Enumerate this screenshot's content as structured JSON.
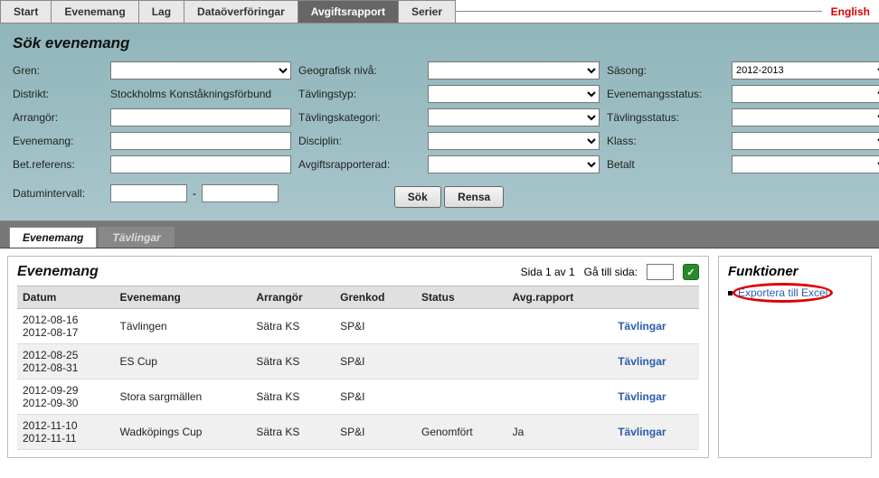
{
  "nav": {
    "tabs": [
      "Start",
      "Evenemang",
      "Lag",
      "Dataöverföringar",
      "Avgiftsrapport",
      "Serier"
    ],
    "active": 4,
    "language": "English"
  },
  "search": {
    "title": "Sök evenemang",
    "labels": {
      "gren": "Gren:",
      "distrikt": "Distrikt:",
      "distrikt_value": "Stockholms Konståkningsförbund",
      "arrangor": "Arrangör:",
      "evenemang": "Evenemang:",
      "betref": "Bet.referens:",
      "datum": "Datumintervall:",
      "geoniva": "Geografisk nivå:",
      "tavtyp": "Tävlingstyp:",
      "tavkat": "Tävlingskategori:",
      "disciplin": "Disciplin:",
      "avgrap": "Avgiftsrapporterad:",
      "sasong": "Säsong:",
      "sasong_value": "2012-2013",
      "evstatus": "Evenemangsstatus:",
      "tavstatus": "Tävlingsstatus:",
      "klass": "Klass:",
      "betalt": "Betalt"
    },
    "buttons": {
      "sok": "Sök",
      "rensa": "Rensa"
    }
  },
  "subtabs": {
    "items": [
      "Evenemang",
      "Tävlingar"
    ],
    "active": 0
  },
  "results": {
    "title": "Evenemang",
    "page_info": "Sida 1 av 1",
    "goto_label": "Gå till sida:",
    "go_symbol": "✓",
    "headers": [
      "Datum",
      "Evenemang",
      "Arrangör",
      "Grenkod",
      "Status",
      "Avg.rapport",
      ""
    ],
    "rows": [
      {
        "d1": "2012-08-16",
        "d2": "2012-08-17",
        "name": "Tävlingen",
        "arr": "Sätra KS",
        "gren": "SP&I",
        "status": "",
        "avg": "",
        "link": "Tävlingar"
      },
      {
        "d1": "2012-08-25",
        "d2": "2012-08-31",
        "name": "ES Cup",
        "arr": "Sätra KS",
        "gren": "SP&I",
        "status": "",
        "avg": "",
        "link": "Tävlingar"
      },
      {
        "d1": "2012-09-29",
        "d2": "2012-09-30",
        "name": "Stora sargmällen",
        "arr": "Sätra KS",
        "gren": "SP&I",
        "status": "",
        "avg": "",
        "link": "Tävlingar"
      },
      {
        "d1": "2012-11-10",
        "d2": "2012-11-11",
        "name": "Wadköpings Cup",
        "arr": "Sätra KS",
        "gren": "SP&I",
        "status": "Genomfört",
        "avg": "Ja",
        "link": "Tävlingar"
      }
    ]
  },
  "functions": {
    "title": "Funktioner",
    "export": "Exportera till Excel"
  }
}
